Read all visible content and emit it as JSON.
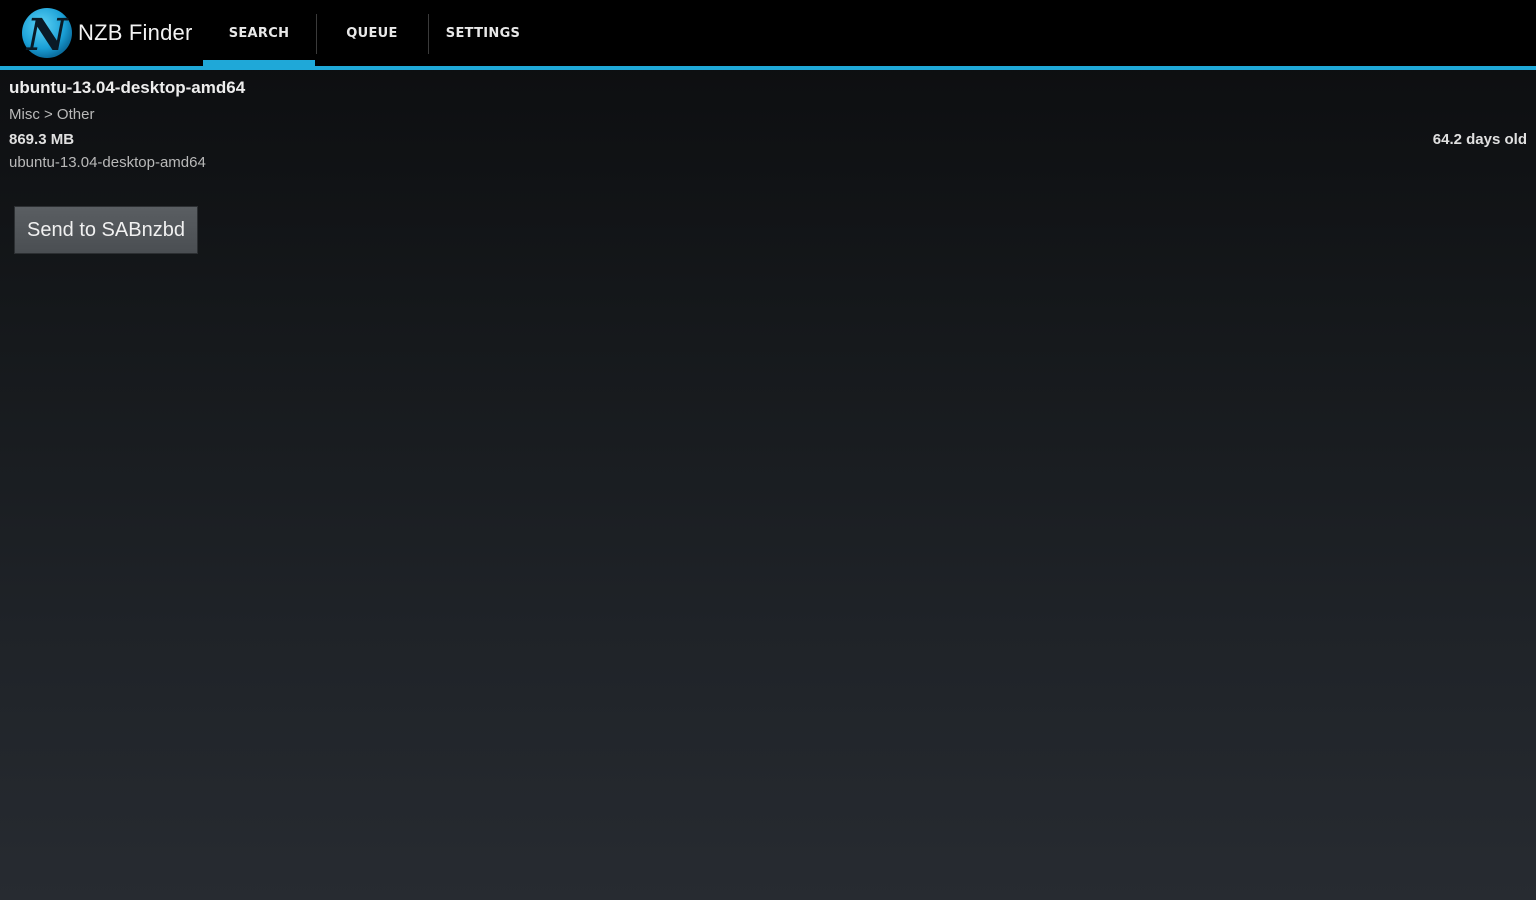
{
  "app": {
    "title": "NZB Finder",
    "accent_color": "#1fa8d8",
    "logo_letter": "N"
  },
  "tabs": [
    {
      "label": "SEARCH",
      "selected": true
    },
    {
      "label": "QUEUE",
      "selected": false
    },
    {
      "label": "SETTINGS",
      "selected": false
    }
  ],
  "detail": {
    "title": "ubuntu-13.04-desktop-amd64",
    "category": "Misc > Other",
    "size": "869.3 MB",
    "age": "64.2 days old",
    "filename": "ubuntu-13.04-desktop-amd64"
  },
  "actions": {
    "send_label": "Send to SABnzbd"
  }
}
